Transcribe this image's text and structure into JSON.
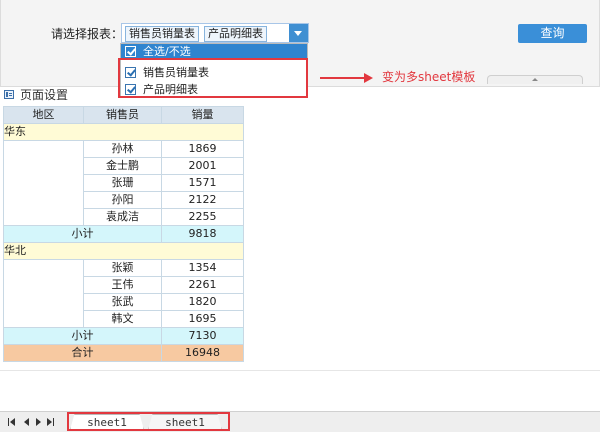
{
  "filter": {
    "label": "请选择报表：",
    "selected_tags": [
      "销售员销量表",
      "产品明细表"
    ],
    "query_button": "查询"
  },
  "dropdown": {
    "select_all": "全选/不选",
    "options": [
      {
        "label": "销售员销量表",
        "checked": true
      },
      {
        "label": "产品明细表",
        "checked": true
      }
    ]
  },
  "annotation": "变为多sheet模板",
  "toolbar": {
    "page_setup": "页面设置"
  },
  "report": {
    "headers": [
      "地区",
      "销售员",
      "销量"
    ],
    "regions": [
      {
        "name": "华东",
        "rows": [
          {
            "name": "孙林",
            "value": "1869"
          },
          {
            "name": "金士鹏",
            "value": "2001"
          },
          {
            "name": "张珊",
            "value": "1571"
          },
          {
            "name": "孙阳",
            "value": "2122"
          },
          {
            "name": "袁成洁",
            "value": "2255"
          }
        ],
        "subtotal_label": "小计",
        "subtotal": "9818"
      },
      {
        "name": "华北",
        "rows": [
          {
            "name": "张颖",
            "value": "1354"
          },
          {
            "name": "王伟",
            "value": "2261"
          },
          {
            "name": "张武",
            "value": "1820"
          },
          {
            "name": "韩文",
            "value": "1695"
          }
        ],
        "subtotal_label": "小计",
        "subtotal": "7130"
      }
    ],
    "total_label": "合计",
    "total": "16948"
  },
  "sheets": [
    "sheet1",
    "sheet1"
  ],
  "colors": {
    "accent_blue": "#3a8fd8",
    "highlight_red": "#e2383f",
    "region_bg": "#fffbd6",
    "subtotal_bg": "#d4f6fb",
    "total_bg": "#f7c9a1",
    "header_bg": "#d9e4ee"
  }
}
